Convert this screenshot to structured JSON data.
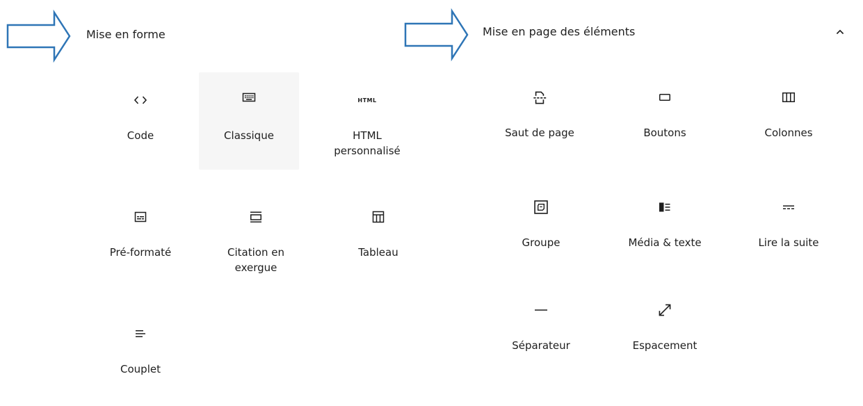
{
  "left_panel": {
    "title": "Mise en forme",
    "blocks": [
      {
        "label": "Code",
        "icon": "code-icon"
      },
      {
        "label": "Classique",
        "icon": "keyboard-icon"
      },
      {
        "label": "HTML personnalisé",
        "icon": "html-icon",
        "icon_text": "HTML"
      },
      {
        "label": "Pré-formaté",
        "icon": "preformatted-icon"
      },
      {
        "label": "Citation en exergue",
        "icon": "pullquote-icon"
      },
      {
        "label": "Tableau",
        "icon": "table-icon"
      },
      {
        "label": "Couplet",
        "icon": "verse-icon"
      }
    ]
  },
  "right_panel": {
    "title": "Mise en page des éléments",
    "blocks": [
      {
        "label": "Saut de page",
        "icon": "page-break-icon"
      },
      {
        "label": "Boutons",
        "icon": "buttons-icon"
      },
      {
        "label": "Colonnes",
        "icon": "columns-icon"
      },
      {
        "label": "Groupe",
        "icon": "group-icon"
      },
      {
        "label": "Média & texte",
        "icon": "media-text-icon"
      },
      {
        "label": "Lire la suite",
        "icon": "more-icon"
      },
      {
        "label": "Séparateur",
        "icon": "separator-icon"
      },
      {
        "label": "Espacement",
        "icon": "spacer-icon"
      }
    ]
  },
  "colors": {
    "arrow_stroke": "#2e75b6",
    "icon": "#1e1e1e",
    "hover_bg": "#f6f6f6"
  }
}
